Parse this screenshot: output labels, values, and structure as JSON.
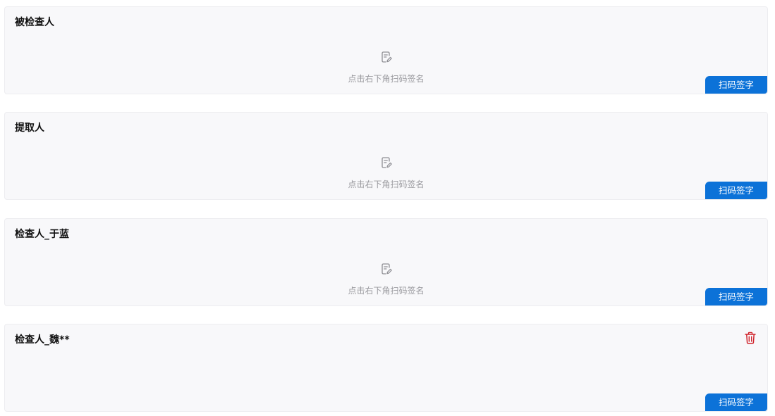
{
  "cards": [
    {
      "title": "被检查人",
      "placeholder_icon": "signature-edit-icon",
      "placeholder_text": "点击右下角扫码签名",
      "button_label": "扫码签字"
    },
    {
      "title": "提取人",
      "placeholder_icon": "signature-edit-icon",
      "placeholder_text": "点击右下角扫码签名",
      "button_label": "扫码签字"
    },
    {
      "title": "检查人_于蓝",
      "placeholder_icon": "signature-edit-icon",
      "placeholder_text": "点击右下角扫码签名",
      "button_label": "扫码签字"
    },
    {
      "title": "检查人_魏**",
      "delete_icon": "trash-icon",
      "button_label": "扫码签字"
    }
  ],
  "colors": {
    "button_bg": "#0c72d8",
    "delete_icon": "#d0232b",
    "placeholder_text": "#9a9a9f",
    "card_bg": "#f8f8fa"
  }
}
